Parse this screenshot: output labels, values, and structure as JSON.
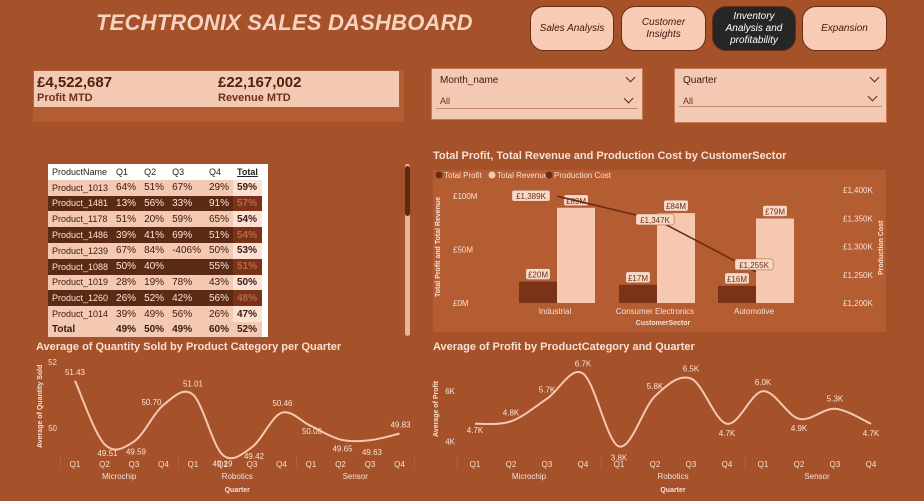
{
  "header": {
    "title": "TECHTRONIX SALES DASHBOARD",
    "nav": [
      "Sales Analysis",
      "Customer Insights",
      "Inventory Analysis and profitability",
      "Expansion"
    ]
  },
  "kpis": [
    {
      "value": "£4,522,687",
      "label": "Profit MTD"
    },
    {
      "value": "£22,167,002",
      "label": "Revenue MTD"
    }
  ],
  "slicers": [
    {
      "title": "Month_name",
      "value": "All"
    },
    {
      "title": "Quarter",
      "value": "All"
    }
  ],
  "matrix": {
    "headers": [
      "ProductName",
      "Q1",
      "Q2",
      "Q3",
      "Q4",
      "Total"
    ],
    "rows": [
      [
        "Product_1013",
        "64%",
        "51%",
        "67%",
        "29%",
        "59%"
      ],
      [
        "Product_1481",
        "13%",
        "56%",
        "33%",
        "91%",
        "57%"
      ],
      [
        "Product_1178",
        "51%",
        "20%",
        "59%",
        "65%",
        "54%"
      ],
      [
        "Product_1486",
        "39%",
        "41%",
        "69%",
        "51%",
        "54%"
      ],
      [
        "Product_1239",
        "67%",
        "84%",
        "-406%",
        "50%",
        "53%"
      ],
      [
        "Product_1088",
        "50%",
        "40%",
        "",
        "55%",
        "51%"
      ],
      [
        "Product_1019",
        "28%",
        "19%",
        "78%",
        "43%",
        "50%"
      ],
      [
        "Product_1260",
        "26%",
        "52%",
        "42%",
        "56%",
        "48%"
      ],
      [
        "Product_1014",
        "39%",
        "49%",
        "56%",
        "26%",
        "47%"
      ]
    ],
    "row_styles": [
      "light",
      "dark",
      "light",
      "dark",
      "light",
      "dark",
      "light",
      "dark",
      "light"
    ],
    "total": [
      "Total",
      "49%",
      "50%",
      "49%",
      "60%",
      "52%"
    ]
  },
  "colors": {
    "background": "#a5512a",
    "panel": "#b55d32",
    "light": "#f4c9b3",
    "dark": "#5a2a14",
    "series_dark": "#7a3218",
    "series_light": "#f6c7b1"
  },
  "combo_chart": {
    "title": "Total Profit, Total Revenue and Production Cost by CustomerSector",
    "legend": [
      "Total Profit",
      "Total Revenue",
      "Production Cost"
    ],
    "y_left_ticks": [
      "£100M",
      "£50M",
      "£0M"
    ],
    "y_right_ticks": [
      "£1,400K",
      "£1,350K",
      "£1,300K",
      "£1,250K",
      "£1,200K"
    ],
    "y_left_label": "Total Profit and Total Revenue",
    "y_right_label": "Production Cost",
    "x_label": "CustomerSector"
  },
  "profit_chart": {
    "title": "Average of Profit by ProductCategory and Quarter",
    "y_label": "Average of Profit",
    "y_ticks": [
      "6K",
      "4K"
    ],
    "x_title": "Quarter",
    "point_labels": [
      "4.7K",
      "4.8K",
      "5.7K",
      "6.7K",
      "3.8K",
      "5.8K",
      "6.5K",
      "4.7K",
      "6.0K",
      "4.9K",
      "5.3K",
      "4.7K"
    ]
  },
  "qty_chart": {
    "title": "Average of Quantity Sold by Product Category per Quarter",
    "y_label": "Average of Quantity Sold",
    "y_ticks": [
      "52",
      "50"
    ],
    "x_title": "Quarter",
    "point_labels": [
      "51.43",
      "49.51",
      "49.59",
      "50.70",
      "51.01",
      "49.19",
      "49.42",
      "50.46",
      "50.06",
      "49.65",
      "49.63",
      "49.83"
    ]
  },
  "chart_data": [
    {
      "type": "bar",
      "title": "Total Profit, Total Revenue and Production Cost by CustomerSector",
      "categories": [
        "Industrial",
        "Consumer Electronics",
        "Automotive"
      ],
      "xlabel": "CustomerSector",
      "ylabel": "Total Profit and Total Revenue",
      "y2label": "Production Cost",
      "ylim": [
        0,
        100
      ],
      "y2lim": [
        1200,
        1400
      ],
      "series": [
        {
          "name": "Total Profit",
          "values": [
            20,
            17,
            16
          ],
          "labels": [
            "£20M",
            "£17M",
            "£16M"
          ],
          "color": "#7a3218"
        },
        {
          "name": "Total Revenue",
          "values": [
            89,
            84,
            79
          ],
          "labels": [
            "£89M",
            "£84M",
            "£79M"
          ],
          "color": "#f6c7b1"
        },
        {
          "name": "Production Cost",
          "type": "line",
          "axis": "right",
          "values": [
            1389,
            1347,
            1255
          ],
          "labels": [
            "£1,389K",
            "£1,347K",
            "£1,255K"
          ],
          "color": "#6e2a10"
        }
      ],
      "legend": "top-left"
    },
    {
      "type": "line",
      "title": "Average of Quantity Sold by Product Category per Quarter",
      "categories": [
        "Microchip",
        "Robotics",
        "Sensor"
      ],
      "x": [
        "Q1",
        "Q2",
        "Q3",
        "Q4",
        "Q1",
        "Q2",
        "Q3",
        "Q4",
        "Q1",
        "Q2",
        "Q3",
        "Q4"
      ],
      "xlabel": "Quarter",
      "ylabel": "Average of Quantity Sold",
      "ylim": [
        49,
        52
      ],
      "values": [
        51.43,
        49.51,
        49.59,
        50.7,
        51.01,
        49.19,
        49.42,
        50.46,
        50.06,
        49.65,
        49.63,
        49.83
      ]
    },
    {
      "type": "line",
      "title": "Average of Profit by ProductCategory and Quarter",
      "categories": [
        "Microchip",
        "Robotics",
        "Sensor"
      ],
      "x": [
        "Q1",
        "Q2",
        "Q3",
        "Q4",
        "Q1",
        "Q2",
        "Q3",
        "Q4",
        "Q1",
        "Q2",
        "Q3",
        "Q4"
      ],
      "xlabel": "Quarter",
      "ylabel": "Average of Profit",
      "ylim": [
        3500,
        7000
      ],
      "values": [
        4700,
        4800,
        5700,
        6700,
        3800,
        5800,
        6500,
        4700,
        6000,
        4900,
        5300,
        4700
      ]
    }
  ]
}
